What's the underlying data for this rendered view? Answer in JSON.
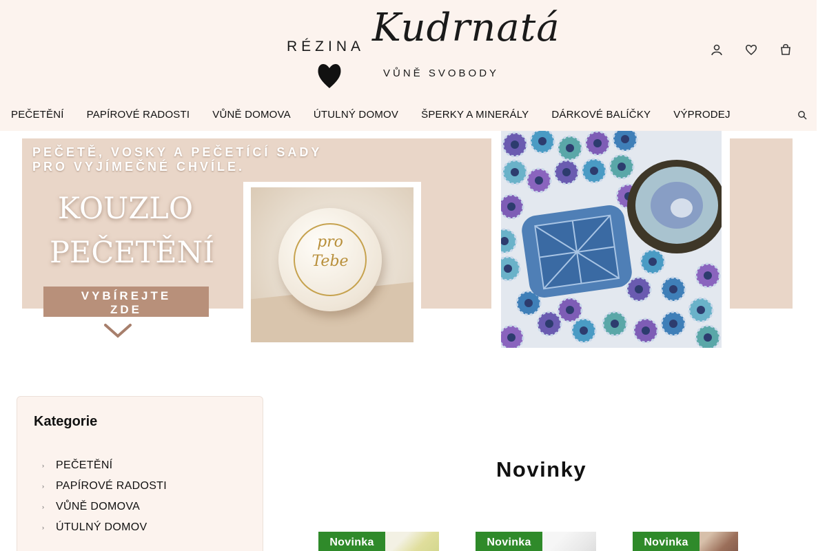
{
  "logo": {
    "rezina": "RÉZINA",
    "script": "Kudrnatá",
    "tagline": "VŮNĚ SVOBODY"
  },
  "header_icons": [
    "user-icon",
    "heart-icon",
    "cart-icon"
  ],
  "nav": {
    "items": [
      "PEČETĚNÍ",
      "PAPÍROVÉ RADOSTI",
      "VŮNĚ DOMOVA",
      "ÚTULNÝ DOMOV",
      "ŠPERKY A MINERÁLY",
      "DÁRKOVÉ BALÍČKY",
      "VÝPRODEJ"
    ]
  },
  "hero": {
    "headline_line1": "PEČETĚ, VOSKY A PEČETÍCÍ SADY",
    "headline_line2": "PRO VYJÍMEČNÉ CHVÍLE.",
    "title_line1": "KOUZLO",
    "title_line2": "PEČETĚNÍ",
    "cta_line1": "VYBÍREJTE",
    "cta_line2": "ZDE",
    "seal_line1": "pro",
    "seal_line2": "Tebe"
  },
  "sidebar": {
    "title": "Kategorie",
    "categories": [
      "PEČETĚNÍ",
      "PAPÍROVÉ RADOSTI",
      "VŮNĚ DOMOVA",
      "ÚTULNÝ DOMOV"
    ]
  },
  "main": {
    "section_title": "Novinky",
    "products": [
      {
        "badge": "Novinka"
      },
      {
        "badge": "Novinka"
      },
      {
        "badge": "Novinka"
      }
    ]
  },
  "colors": {
    "header_bg": "#fcf3ee",
    "hero_bg": "#e9d6c8",
    "cta_bg": "#b8907a",
    "badge_bg": "#2f8a2a"
  }
}
